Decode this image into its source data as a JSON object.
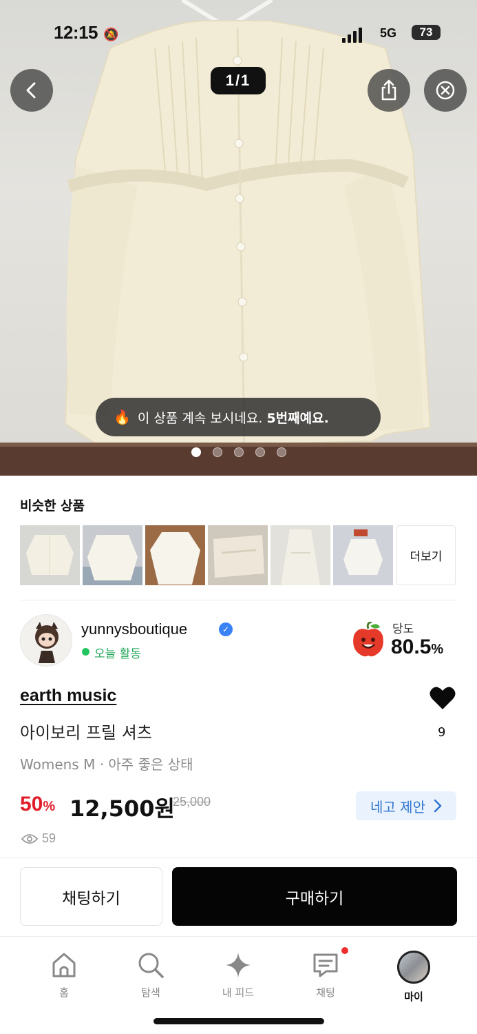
{
  "status_bar": {
    "time": "12:15",
    "network": "5G",
    "battery": "73"
  },
  "photo_viewer": {
    "counter": "1/1",
    "toast_prefix": "이 상품 계속 보시네요.",
    "toast_emphasis": "5번째예요.",
    "page_count": 5,
    "active_page": 1
  },
  "similar": {
    "title": "비슷한 상품",
    "more_label": "더보기",
    "thumbnail_count": 6
  },
  "seller": {
    "name": "yunnysboutique",
    "activity": "오늘 활동",
    "sweetness_label": "당도",
    "sweetness_value": "80.5",
    "sweetness_unit": "%"
  },
  "product": {
    "brand": "earth music",
    "title": "아이보리 프릴 셔츠",
    "meta": "Womens M · 아주 좋은 상태",
    "discount": "50",
    "discount_unit": "%",
    "price": "12,500원",
    "original_price": "25,000",
    "likes": "9",
    "views": "59",
    "offer_label": "네고 제안"
  },
  "actions": {
    "chat": "채팅하기",
    "buy": "구매하기"
  },
  "nav": {
    "home": "홈",
    "search": "탐색",
    "feed": "내 피드",
    "chat": "채팅",
    "me": "마이"
  },
  "colors": {
    "discount_red": "#e11d2a",
    "offer_blue": "#2f74d0",
    "active_green": "#22c55e",
    "buy_black": "#050505"
  }
}
